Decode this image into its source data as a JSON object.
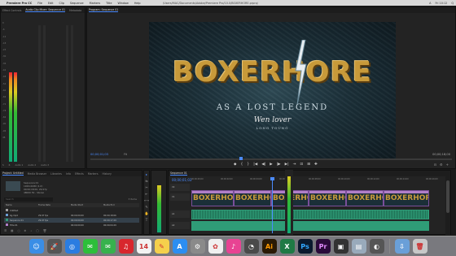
{
  "menubar": {
    "apple": "",
    "app_name": "Premiere Pro CC",
    "items": [
      "File",
      "Edit",
      "Clip",
      "Sequence",
      "Markers",
      "Title",
      "Window",
      "Help"
    ],
    "center_title": "/Users/MAC/Documents/Adobe/Premiere Pro/10.0/BOXERHORE.prproj",
    "status_right": [
      "A",
      "Fri 10:12",
      "Q"
    ]
  },
  "meters_panel": {
    "tabs": [
      "Effect Controls",
      "Audio Clip Mixer: Sequence 01",
      "Metadata"
    ],
    "scale": [
      "0",
      "-6",
      "-12",
      "-18",
      "-24",
      "-30",
      "-36",
      "-42",
      "-48",
      "-54",
      "-60",
      "-66",
      "-72",
      "-78",
      "-84",
      "-90",
      "-96",
      "dB"
    ],
    "labels": [
      "S",
      "R",
      "Audio 1",
      "Audio 2",
      "Audio 3"
    ]
  },
  "program_panel": {
    "tabs": [
      "Program: Sequence 01"
    ],
    "title_main": "BOXERHORE",
    "title_sub": "AS A LOST LEGEND",
    "title_sig": "Wen lover",
    "title_sig2": "LONG TOUNG",
    "timecode": "00;00;01;03",
    "fit": "Fit",
    "duration": "00;00;18;00",
    "transport": [
      "◆",
      "{",
      "}",
      "|◀",
      "◀|",
      "▶",
      "|▶",
      "▶|",
      "⇥",
      "⊡",
      "⊞",
      "✚"
    ],
    "tools": [
      "⊟",
      "⚙",
      "+"
    ]
  },
  "project_panel": {
    "tabs": [
      "Project: Untitled",
      "Media Browser",
      "Libraries",
      "Info",
      "Effects",
      "Markers",
      "History"
    ],
    "meta": [
      "Sequence 01",
      "1920x1080 (1.0)",
      "00;00;18;00, 29.97p",
      "48000 Hz - Stereo"
    ],
    "search_placeholder": "Search",
    "count": "3 Items",
    "columns": [
      "Name",
      "Frame Rate",
      "Media Start",
      "Media End"
    ],
    "rows": [
      {
        "name": "Untitled",
        "rate": "",
        "start": "",
        "end": "",
        "color": "#a0a0a0"
      },
      {
        "name": "bg.mp4",
        "rate": "29.97 fps",
        "start": "00;00;00;00",
        "end": "00;00;18;06",
        "color": "#6b9bd1"
      },
      {
        "name": "Sequence 01",
        "rate": "29.97 fps",
        "start": "00;00;00;00",
        "end": "00;00;17;29",
        "color": "#2f9c77"
      },
      {
        "name": "Title 01",
        "rate": "",
        "start": "00;00;00;00",
        "end": "00;00;04;29",
        "color": "#b07fc7"
      }
    ],
    "footer": [
      "☰",
      "▦",
      "○",
      "⊕",
      "⌕",
      "▢",
      "🗑"
    ]
  },
  "tools": [
    "▸",
    "⇆",
    "✂",
    "⇤",
    "⟷",
    "✎",
    "✋",
    "T"
  ],
  "timeline_panel": {
    "tabs": [
      "Sequence 01"
    ],
    "timecode": "00;00;01;03",
    "ruler": [
      "00;00;00;00",
      "00;00;02;00",
      "00;00;04;00",
      "00;00;06;00",
      "00;00;08;00",
      "00;00;10;00",
      "00;00;12;00",
      "00;00;14;00",
      "00;00;16;00"
    ],
    "tracks": [
      "V2",
      "V1",
      "A1",
      "A2"
    ],
    "clip_title": "BOXERHORE",
    "clip_count": 6
  },
  "dock": {
    "icons": [
      {
        "name": "finder",
        "glyph": "☺",
        "color": "#3a8ee6"
      },
      {
        "name": "launchpad",
        "glyph": "🚀",
        "color": "#555"
      },
      {
        "name": "safari",
        "glyph": "◎",
        "color": "#2a7de1"
      },
      {
        "name": "wechat",
        "glyph": "✉",
        "color": "#2dbf3a"
      },
      {
        "name": "messages",
        "glyph": "✉",
        "color": "#37b24d"
      },
      {
        "name": "netease-music",
        "glyph": "♫",
        "color": "#d8262d"
      },
      {
        "name": "calendar",
        "glyph": "14",
        "color": "#f2f2f2"
      },
      {
        "name": "notes",
        "glyph": "✎",
        "color": "#f5d04c"
      },
      {
        "name": "appstore",
        "glyph": "A",
        "color": "#2c8ef2"
      },
      {
        "name": "system-preferences",
        "glyph": "⚙",
        "color": "#8a8a8a"
      },
      {
        "name": "photos",
        "glyph": "✿",
        "color": "#f0f0f0"
      },
      {
        "name": "itunes",
        "glyph": "♪",
        "color": "#e84393"
      },
      {
        "name": "activity",
        "glyph": "◔",
        "color": "#4a4a4a"
      },
      {
        "name": "illustrator",
        "glyph": "Ai",
        "color": "#2a1a05"
      },
      {
        "name": "excel",
        "glyph": "X",
        "color": "#1f7a45"
      },
      {
        "name": "photoshop",
        "glyph": "Ps",
        "color": "#0a1a2e"
      },
      {
        "name": "premiere",
        "glyph": "Pr",
        "color": "#2a0a3a"
      },
      {
        "name": "after-effects",
        "glyph": "▣",
        "color": "#333"
      },
      {
        "name": "preview",
        "glyph": "▤",
        "color": "#9ab"
      },
      {
        "name": "quicktime",
        "glyph": "◐",
        "color": "#555"
      },
      {
        "name": "downloads",
        "glyph": "⇩",
        "color": "#6a9fd8"
      },
      {
        "name": "trash",
        "glyph": "🗑",
        "color": "#c8c8c8"
      }
    ]
  }
}
